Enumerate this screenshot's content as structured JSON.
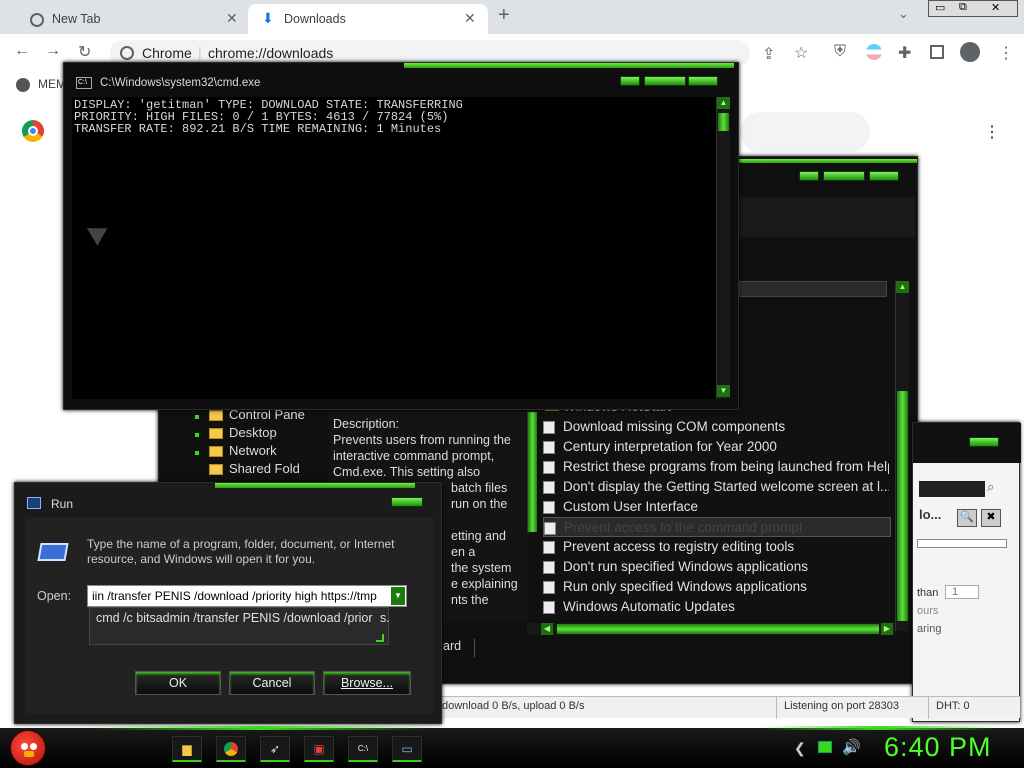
{
  "chrome": {
    "tabs": [
      {
        "label": "New Tab",
        "active": false
      },
      {
        "label": "Downloads",
        "active": true
      }
    ],
    "new_tab_glyph": "+",
    "omnibox_site": "Chrome",
    "omnibox_url": "chrome://downloads",
    "bookmark_partial": "MEM",
    "window_controls": [
      "minimize-icon",
      "restore-icon",
      "close-icon"
    ]
  },
  "cmd": {
    "title": "C:\\Windows\\system32\\cmd.exe",
    "lines": [
      "DISPLAY: 'getitman' TYPE: DOWNLOAD STATE: TRANSFERRING",
      "PRIORITY: HIGH FILES: 0 / 1 BYTES: 4613 / 77824 (5%)",
      "TRANSFER RATE: 892.21 B/S TIME REMAINING: 1 Minutes"
    ]
  },
  "gpedit": {
    "tree": [
      "Control Pane",
      "Desktop",
      "Network",
      "Shared Fold"
    ],
    "description_heading": "Description:",
    "description_lines": [
      "Prevents users from running the",
      "interactive command prompt,",
      "Cmd.exe. This setting also",
      "batch files",
      "run on the",
      "etting and",
      "en a",
      "the system",
      "e explaining",
      "nts the"
    ],
    "settings": [
      "Windows HotStart",
      "Download missing COM components",
      "Century interpretation for Year 2000",
      "Restrict these programs from being launched from Help",
      "Don't display the Getting Started welcome screen at l...",
      "Custom User Interface",
      "Prevent access to the command prompt",
      "Prevent access to registry editing tools",
      "Don't run specified Windows applications",
      "Run only specified Windows applications",
      "Windows Automatic Updates"
    ],
    "selected_index": 6,
    "tab_partial": "ard"
  },
  "torrent": {
    "status_transfer": "download 0 B/s, upload 0 B/s",
    "status_port": "Listening on port 28303",
    "status_dht": "DHT: 0",
    "right_partial": [
      "lo...",
      "than",
      "1",
      "ours",
      "aring"
    ]
  },
  "run": {
    "title": "Run",
    "description": "Type the name of a program, folder, document, or Internet resource, and Windows will open it for you.",
    "open_label": "Open:",
    "input_value": "iin /transfer PENIS /download /priority high https://tmp",
    "suggestion": "cmd /c bitsadmin /transfer PENIS /download /prior",
    "suggestion_tail": "s.",
    "ok_label": "OK",
    "cancel_label": "Cancel",
    "browse_label": "Browse..."
  },
  "taskbar": {
    "clock": "6:40 PM",
    "apps": [
      "folder-icon",
      "chrome-icon",
      "rocket-icon",
      "app-icon",
      "cmd-icon",
      "run-icon"
    ],
    "tray": [
      "back-icon",
      "network-icon",
      "volume-icon"
    ]
  },
  "colors": {
    "accent": "#3cd820",
    "clock": "#4cff2a"
  }
}
